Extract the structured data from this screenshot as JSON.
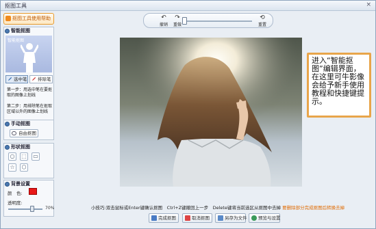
{
  "window": {
    "title": "抠图工具",
    "close_glyph": "×"
  },
  "left_panel": {
    "help_button": "抠图工具使用帮助",
    "smart": {
      "heading": "智能抠图",
      "image_label": "智能抠图",
      "keep_brush": "选中笔",
      "erase_brush": "排除笔",
      "step1": "第一步：用选中笔在要抠取的图像上划线",
      "step2": "第二步：用排除笔在抠取区域以外的图像上划线"
    },
    "manual": {
      "heading": "手动抠图",
      "button": "自由抠图"
    },
    "shape": {
      "heading": "形状抠图",
      "shapes": [
        "○",
        "⬚",
        "▭",
        "☆",
        "⬡"
      ]
    },
    "background": {
      "heading": "背景设置",
      "color_label": "颜　色:",
      "color_value": "#e81818",
      "transparency_label": "透明度:",
      "transparency_value": "70%",
      "transparency_fraction": 0.7
    }
  },
  "toolbar": {
    "undo": "撤销",
    "redo": "重做",
    "reset": "重置",
    "zoom_fraction": 0.0
  },
  "canvas": {
    "tip": "进入“智能抠图”编辑界面，在这里可牛影像会给予新手使用教程和快捷键提示。"
  },
  "bottom": {
    "tips_label": "小技巧:",
    "tips": "双击鼠标或Enter键确认抠图　Ctrl+Z键撤回上一步　Delete键将当前选区从抠图中去掉",
    "tips_link": "要删除部分完成抠图后转换去掉",
    "buttons": {
      "complete": "完成抠图",
      "cancel": "取消抠图",
      "save": "另存为文件",
      "preview": "预览与设置"
    }
  }
}
